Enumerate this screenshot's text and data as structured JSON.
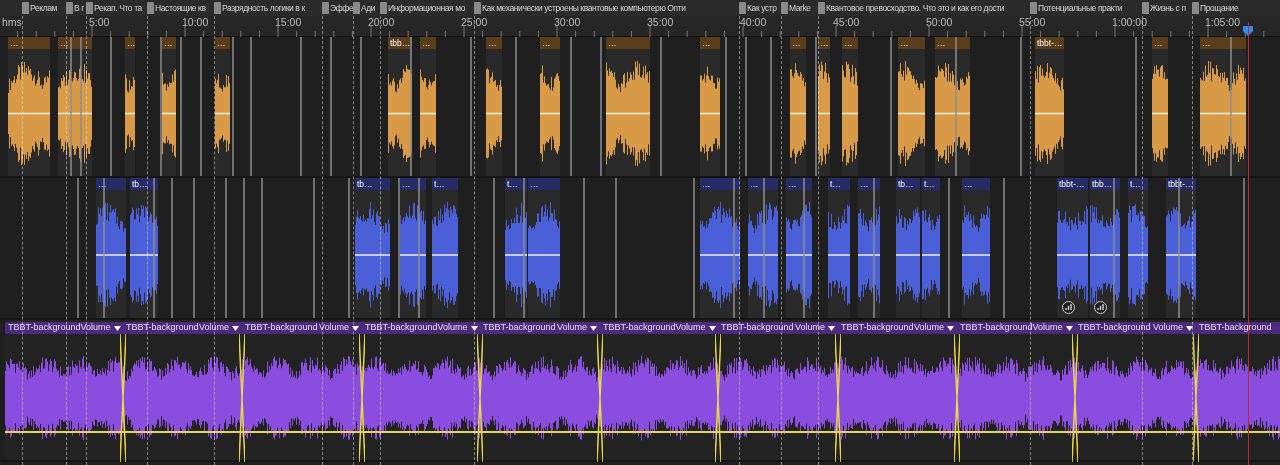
{
  "markers": [
    {
      "label": "Реклам"
    },
    {
      "label": "В г"
    },
    {
      "label": "Рекап. Что та"
    },
    {
      "label": "Настоящие кв"
    },
    {
      "label": "Разрядность логики в к"
    },
    {
      "label": "Эффе"
    },
    {
      "label": "Ади"
    },
    {
      "label": "Информационная мо"
    },
    {
      "label": "Как механически устроены квантовые компьютерю Опти"
    },
    {
      "label": "Как устр"
    },
    {
      "label": "Marke"
    },
    {
      "label": "Квантовое превосходство. Что это и как его дости"
    },
    {
      "label": "Потенциальные практи"
    },
    {
      "label": "Жизнь с п"
    },
    {
      "label": "Прощание"
    }
  ],
  "ruler": {
    "unit": "hms",
    "ticks": [
      "5:00",
      "10:00",
      "15:00",
      "20:00",
      "25:00",
      "30:00",
      "35:00",
      "40:00",
      "45:00",
      "50:00",
      "55:00",
      "1:00:00",
      "1:05:00"
    ]
  },
  "tracks": [
    {
      "kind": "voice",
      "color": "#d99a48",
      "clips": [
        {
          "label": "…"
        },
        {
          "label": "…"
        },
        {
          "label": "…"
        },
        {
          "label": "…"
        },
        {
          "label": "…"
        },
        {
          "label": "tbb…"
        },
        {
          "label": "…"
        },
        {
          "label": "…"
        },
        {
          "label": "…"
        },
        {
          "label": "…"
        },
        {
          "label": "…"
        },
        {
          "label": "…"
        },
        {
          "label": "…"
        },
        {
          "label": "…"
        },
        {
          "label": "…"
        },
        {
          "label": "…"
        },
        {
          "label": "tbbt-…"
        },
        {
          "label": "…"
        },
        {
          "label": "…"
        }
      ]
    },
    {
      "kind": "voice",
      "color": "#4a5fd8",
      "clips": [
        {
          "label": "…"
        },
        {
          "label": "tb…"
        },
        {
          "label": "tb…"
        },
        {
          "label": "…"
        },
        {
          "label": "t…"
        },
        {
          "label": "t…"
        },
        {
          "label": "…"
        },
        {
          "label": "…"
        },
        {
          "label": "…"
        },
        {
          "label": "…"
        },
        {
          "label": "t…"
        },
        {
          "label": "…"
        },
        {
          "label": "tb…"
        },
        {
          "label": "t…"
        },
        {
          "label": "…"
        },
        {
          "label": "tbbt-…"
        },
        {
          "label": "tbb…"
        },
        {
          "label": "t…"
        },
        {
          "label": "tbbt-…"
        }
      ]
    },
    {
      "kind": "music",
      "color": "#8a4de0",
      "clips": [
        {
          "title": "TBBT-background",
          "effect": "Volume"
        },
        {
          "title": "TBBT-background",
          "effect": "Volume"
        },
        {
          "title": "TBBT-background",
          "effect": "Volume"
        },
        {
          "title": "TBBT-background",
          "effect": "Volume"
        },
        {
          "title": "TBBT-background",
          "effect": "Volume"
        },
        {
          "title": "TBBT-background",
          "effect": "Volume"
        },
        {
          "title": "TBBT-background",
          "effect": "Volume"
        },
        {
          "title": "TBBT-background",
          "effect": "Volume"
        },
        {
          "title": "TBBT-background",
          "effect": "Volume"
        },
        {
          "title": "TBBT-background",
          "effect": "Volume"
        },
        {
          "title": "TBBT-background"
        }
      ]
    }
  ]
}
